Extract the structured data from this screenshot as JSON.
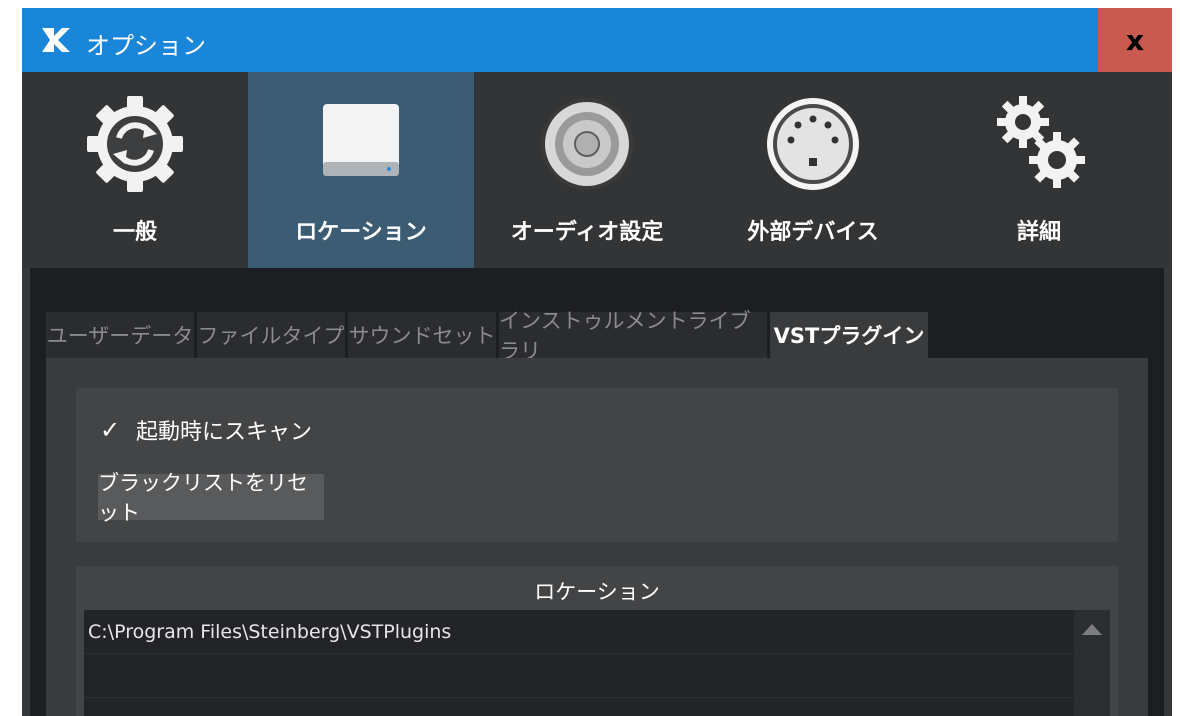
{
  "window": {
    "title": "オプション",
    "close_label": "x"
  },
  "nav": {
    "items": [
      {
        "label": "一般",
        "icon": "general-gear-icon"
      },
      {
        "label": "ロケーション",
        "icon": "drive-icon",
        "active": true
      },
      {
        "label": "オーディオ設定",
        "icon": "speaker-icon"
      },
      {
        "label": "外部デバイス",
        "icon": "midi-port-icon"
      },
      {
        "label": "詳細",
        "icon": "gears-icon"
      }
    ]
  },
  "tabs": [
    {
      "label": "ユーザーデータ"
    },
    {
      "label": "ファイルタイプ"
    },
    {
      "label": "サウンドセット"
    },
    {
      "label": "インストゥルメントライブラリ"
    },
    {
      "label": "VSTプラグイン",
      "active": true
    }
  ],
  "vst": {
    "scan_on_startup": {
      "label": "起動時にスキャン",
      "checked": true,
      "check_glyph": "✓"
    },
    "reset_blacklist_label": "ブラックリストをリセット",
    "locations_header": "ロケーション",
    "locations": [
      "C:\\Program Files\\Steinberg\\VSTPlugins",
      "",
      ""
    ]
  },
  "colors": {
    "titlebar": "#1a86d9",
    "close": "#c85a4f",
    "nav_active": "#3b5c72",
    "nav_bg": "#323436"
  }
}
